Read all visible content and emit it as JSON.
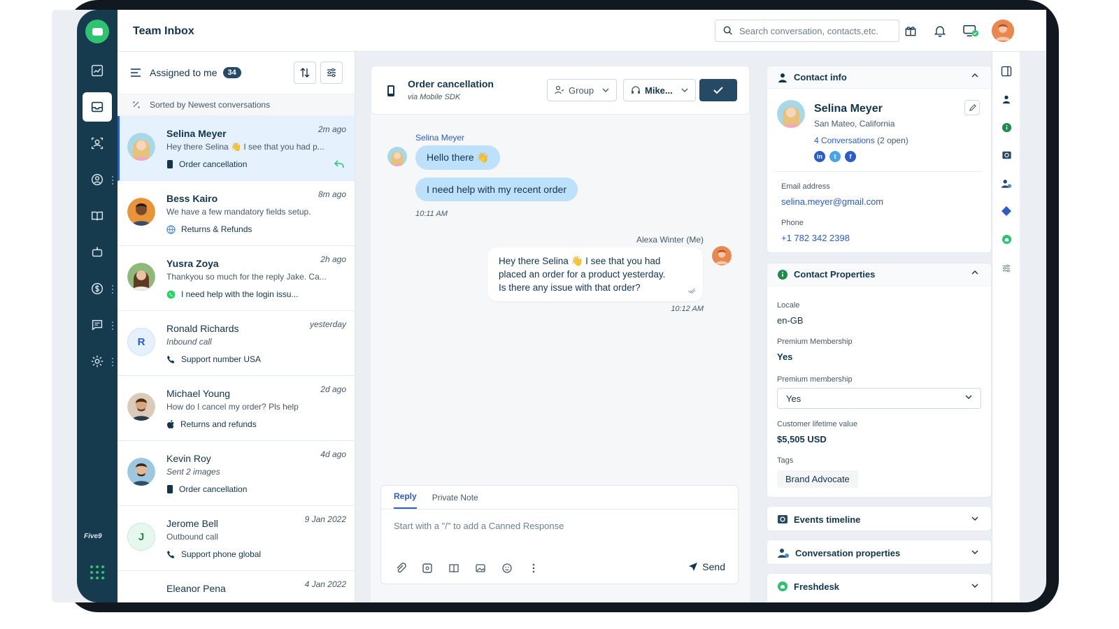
{
  "header": {
    "title": "Team Inbox",
    "search_placeholder": "Search conversation, contacts,etc."
  },
  "list": {
    "filter_label": "Assigned to me",
    "filter_count": "34",
    "sort_text": "Sorted by Newest conversations",
    "conversations": [
      {
        "name": "Selina Meyer",
        "time": "2m ago",
        "preview": "Hey there Selina 👋 I see that you had p...",
        "channel": "Order cancellation"
      },
      {
        "name": "Bess Kairo",
        "time": "8m ago",
        "preview": "We have a few mandatory fields setup.",
        "channel": "Returns & Refunds"
      },
      {
        "name": "Yusra Zoya",
        "time": "2h ago",
        "preview": "Thankyou so much for the reply Jake. Ca...",
        "channel": "I need help with the login issu..."
      },
      {
        "name": "Ronald Richards",
        "time": "yesterday",
        "preview": "Inbound call",
        "channel": "Support number USA",
        "initial": "R"
      },
      {
        "name": "Michael Young",
        "time": "2d ago",
        "preview": "How do I cancel my order? Pls help",
        "channel": "Returns and refunds"
      },
      {
        "name": "Kevin Roy",
        "time": "4d ago",
        "preview": "Sent 2 images",
        "channel": "Order cancellation"
      },
      {
        "name": "Jerome Bell",
        "time": "9 Jan 2022",
        "preview": "Outbound call",
        "channel": "Support phone global",
        "initial": "J"
      },
      {
        "name": "Eleanor Pena",
        "time": "4 Jan 2022"
      }
    ]
  },
  "chat": {
    "title": "Order cancellation",
    "subtitle": "via Mobile SDK",
    "group_label": "Group",
    "agent_label": "Mike...",
    "customer_name": "Selina Meyer",
    "msg1": "Hello there 👋",
    "msg2": "I need help with my recent order",
    "time1": "10:11 AM",
    "agent_name": "Alexa Winter (Me)",
    "reply_line1": "Hey there Selina 👋 I see that you had",
    "reply_line2": "placed an order for a product yesterday.",
    "reply_line3": "Is there any issue with that order?",
    "time2": "10:12 AM",
    "tab_reply": "Reply",
    "tab_note": "Private Note",
    "composer_placeholder": "Start with a \"/\" to add a Canned Response",
    "send_label": "Send"
  },
  "contact": {
    "section_title": "Contact info",
    "name": "Selina Meyer",
    "location": "San Mateo, California",
    "conversations_link": "4 Conversations",
    "open_count": "(2 open)",
    "social": {
      "linkedin": "in",
      "twitter": "t",
      "facebook": "f"
    },
    "email_label": "Email address",
    "email": "selina.meyer@gmail.com",
    "phone_label": "Phone",
    "phone": "+1 782 342 2398"
  },
  "properties": {
    "section_title": "Contact Properties",
    "locale_label": "Locale",
    "locale": "en-GB",
    "premium_label": "Premium Membership",
    "premium": "Yes",
    "premium_select_label": "Premium membership",
    "premium_select_value": "Yes",
    "clv_label": "Customer lifetime value",
    "clv": "$5,505 USD",
    "tags_label": "Tags",
    "tag": "Brand Advocate"
  },
  "panels": {
    "events": "Events timeline",
    "conv_props": "Conversation properties",
    "freshdesk": "Freshdesk"
  },
  "brand": {
    "rail_label": "Five9"
  },
  "colors": {
    "accent": "#2c5cc5",
    "rail": "#163b4f",
    "bubble": "#bde0fb",
    "green": "#2ec371"
  }
}
